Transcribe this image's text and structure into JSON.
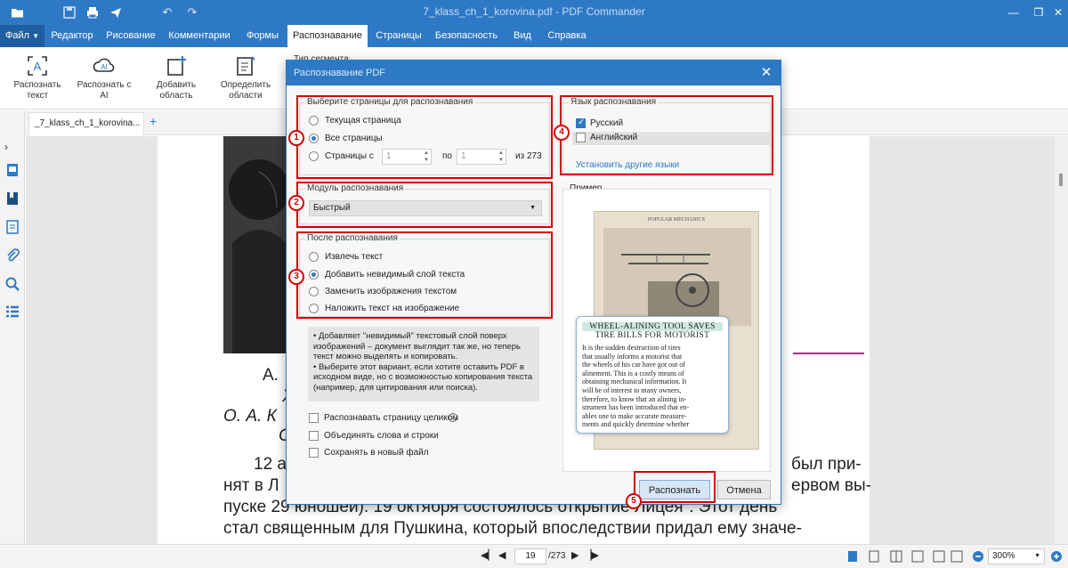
{
  "titlebar": {
    "title": "7_klass_ch_1_korovina.pdf - PDF Commander",
    "icons": [
      "folder-open-icon",
      "save-icon",
      "print-icon",
      "send-icon",
      "undo-icon",
      "redo-icon"
    ]
  },
  "menu": {
    "file": "Файл",
    "tabs": [
      "Редактор",
      "Рисование",
      "Комментарии",
      "Формы",
      "Распознавание",
      "Страницы",
      "Безопасность",
      "Вид",
      "Справка"
    ],
    "active": "Распознавание"
  },
  "ribbon": {
    "recognize_text": "Распознать текст",
    "recognize_ai": "Распознать с AI",
    "add_area": "Добавить область",
    "detect_areas": "Определить области",
    "segment_type": "Тип сегмента"
  },
  "doc_tab": {
    "name": "_7_klass_ch_1_korovina...",
    "add": "+"
  },
  "document": {
    "lines": [
      "А.",
      "Х",
      "О. А. К",
      "С",
      "12 а",
      "нят в Л",
      "пуске 29 юношей). 19 октября состоялось открытие Лицея\". Этот день",
      "стал священным для Пушкина, который впоследствии придал ему значе-"
    ],
    "right_lines": [
      "был при-",
      "ервом вы-"
    ]
  },
  "dialog": {
    "title": "Распознавание PDF",
    "pages_group": {
      "label": "Выберите страницы для распознавания",
      "current": "Текущая страница",
      "all": "Все страницы",
      "range": "Страницы с",
      "from": "1",
      "to_label": "по",
      "to": "1",
      "of": "из 273"
    },
    "module_group": {
      "label": "Модуль распознавания",
      "selected": "Быстрый"
    },
    "after_group": {
      "label": "После распознавания",
      "options": [
        "Извлечь текст",
        "Добавить невидимый слой текста",
        "Заменить изображения текстом",
        "Наложить текст на изображение"
      ]
    },
    "info": [
      "Добавляет \"невидимый\" текстовый слой поверх изображений – документ выглядит так же, но теперь текст можно выделять и копировать.",
      "Выберите этот вариант, если хотите оставить PDF в исходном виде, но с возможностью копирования текста (например, для цитирования или поиска)."
    ],
    "checkboxes": [
      "Распознавать страницу целиком",
      "Объединять слова и строки",
      "Сохранять в новый файл"
    ],
    "lang_group": {
      "label": "Язык распознавания",
      "langs": [
        "Русский",
        "Английский"
      ],
      "more": "Установить другие языки"
    },
    "example": {
      "label": "Пример",
      "mag_title": "POPULAR MECHANICS",
      "headline1": "WHEEL-ALINING TOOL SAVES",
      "headline2": "TIRE BILLS FOR MOTORIST",
      "body": [
        "It is the sudden destruction of tires",
        "that usually informs a motorist that",
        "the wheels of his car have got out of",
        "alinement. This is a costly means of",
        "obtaining mechanical information. It",
        "will be of interest to many owners,",
        "therefore, to know that an alining in-",
        "strument has been introduced that en-",
        "ables one to make accurate measure-",
        "ments and quickly determine whether"
      ]
    },
    "buttons": {
      "recognize": "Распознать",
      "cancel": "Отмена"
    },
    "markers": [
      "1",
      "2",
      "3",
      "4",
      "5"
    ]
  },
  "status": {
    "page": "19",
    "total": "/273",
    "zoom": "300%"
  },
  "colors": {
    "accent": "#2e79c5",
    "highlight": "#d40000"
  }
}
